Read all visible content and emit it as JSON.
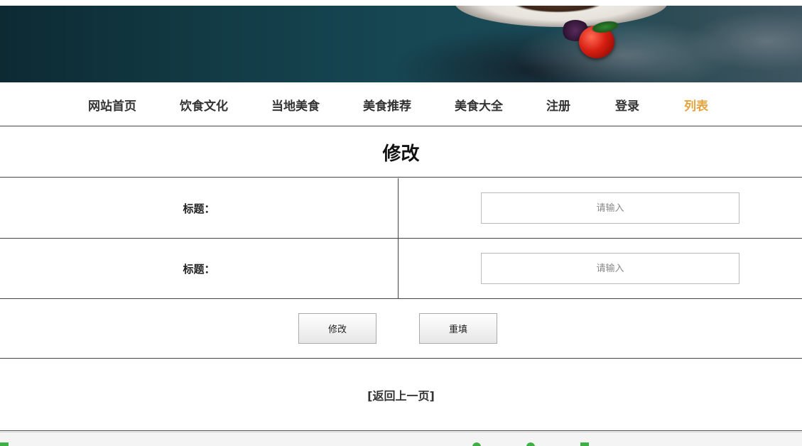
{
  "nav": {
    "items": [
      {
        "label": "网站首页"
      },
      {
        "label": "饮食文化"
      },
      {
        "label": "当地美食"
      },
      {
        "label": "美食推荐"
      },
      {
        "label": "美食大全"
      },
      {
        "label": "注册"
      },
      {
        "label": "登录"
      },
      {
        "label": "列表",
        "active": true
      }
    ],
    "active_color": "#e6a23c"
  },
  "page": {
    "title": "修改"
  },
  "form": {
    "rows": [
      {
        "label": "标题：",
        "placeholder": "请输入",
        "value": ""
      },
      {
        "label": "标题：",
        "placeholder": "请输入",
        "value": ""
      }
    ]
  },
  "buttons": {
    "submit_label": "修改",
    "reset_label": "重填"
  },
  "back": {
    "label": "[返回上一页]"
  }
}
